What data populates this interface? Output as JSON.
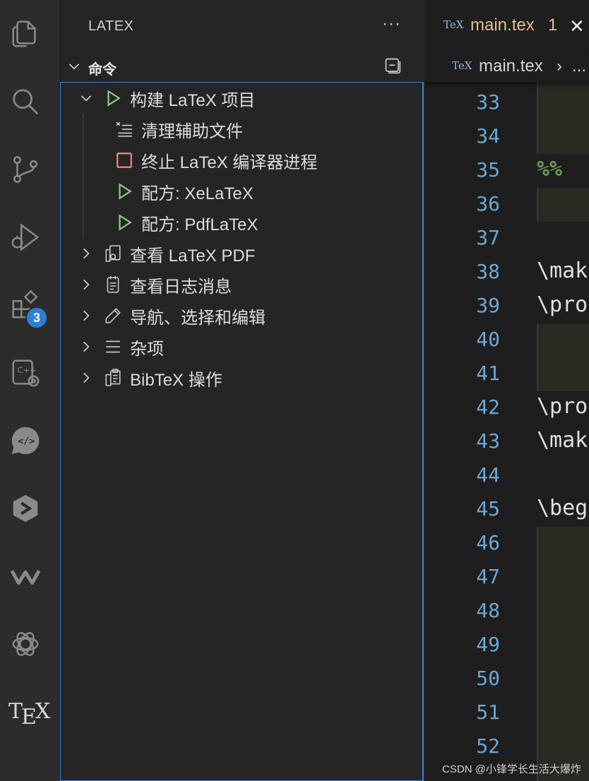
{
  "activity_bar": {
    "items": [
      "explorer-icon",
      "search-icon",
      "source-control-icon",
      "run-debug-icon",
      "extensions-icon",
      "cpp-config-icon",
      "live-share-icon",
      "deploy-icon",
      "wakatime-icon",
      "openai-icon",
      "tex-icon"
    ],
    "extensions_badge": "3",
    "tex_logo_t": "T",
    "tex_logo_e": "E",
    "tex_logo_x": "X"
  },
  "sidebar": {
    "title": "LATEX",
    "more": "···",
    "section_title": "命令",
    "tree": [
      {
        "label": "构建 LaTeX 项目",
        "icon": "play-icon",
        "expanded": true
      },
      {
        "label": "清理辅助文件",
        "icon": "clear-all-icon"
      },
      {
        "label": "终止 LaTeX 编译器进程",
        "icon": "stop-icon"
      },
      {
        "label": "配方: XeLaTeX",
        "icon": "play-icon"
      },
      {
        "label": "配方: PdfLaTeX",
        "icon": "play-icon"
      },
      {
        "label": "查看 LaTeX PDF",
        "icon": "open-preview-icon"
      },
      {
        "label": "查看日志消息",
        "icon": "notebook-icon"
      },
      {
        "label": "导航、选择和编辑",
        "icon": "edit-icon"
      },
      {
        "label": "杂项",
        "icon": "list-icon"
      },
      {
        "label": "BibTeX 操作",
        "icon": "clipboard-copy-icon"
      }
    ]
  },
  "editor": {
    "tab": {
      "file_type": "TeX",
      "name": "main.tex",
      "problems": "1",
      "close": "✕"
    },
    "breadcrumb": {
      "file_type": "TeX",
      "name": "main.tex",
      "sep": "›",
      "more": "..."
    },
    "line_numbers": [
      "33",
      "34",
      "35",
      "36",
      "37",
      "38",
      "39",
      "40",
      "41",
      "42",
      "43",
      "44",
      "45",
      "46",
      "47",
      "48",
      "49",
      "50",
      "51",
      "52"
    ],
    "code_lines": {
      "l35": "%%",
      "l38": "\\mak",
      "l39": "\\pro",
      "l42": "\\pro",
      "l43": "\\mak",
      "l45": "\\beg"
    }
  },
  "watermark": "CSDN @小锋学长生活大爆炸",
  "colors": {
    "accent": "#3c7fd6",
    "play": "#89d185",
    "stop": "#f48771",
    "tab_modified": "#e2c08d",
    "line_number": "#6aa7d6",
    "comment": "#6a9955"
  }
}
